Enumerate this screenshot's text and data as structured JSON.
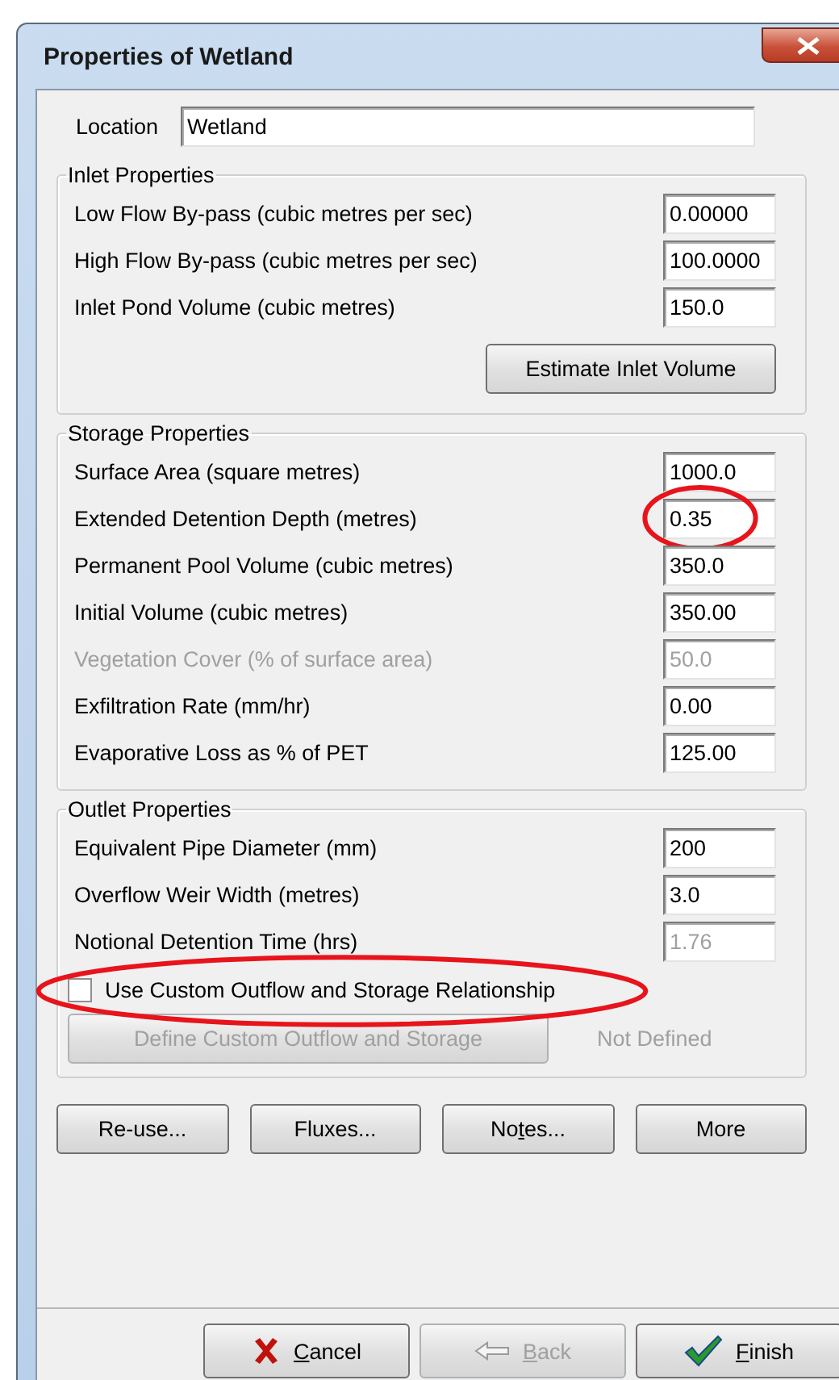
{
  "window": {
    "title": "Properties of Wetland"
  },
  "location": {
    "label": "Location",
    "value": "Wetland"
  },
  "groups": [
    {
      "title": "Inlet Properties",
      "fields": [
        {
          "label": "Low Flow By-pass (cubic metres per sec)",
          "value": "0.00000",
          "disabled": false,
          "value_disabled": false,
          "highlighted": false
        },
        {
          "label": "High Flow By-pass (cubic metres per sec)",
          "value": "100.0000",
          "disabled": false,
          "value_disabled": false,
          "highlighted": false
        },
        {
          "label": "Inlet Pond Volume (cubic metres)",
          "value": "150.0",
          "disabled": false,
          "value_disabled": false,
          "highlighted": false
        }
      ],
      "button": {
        "label": "Estimate Inlet Volume"
      }
    },
    {
      "title": "Storage Properties",
      "fields": [
        {
          "label": "Surface Area (square metres)",
          "value": "1000.0",
          "disabled": false,
          "value_disabled": false,
          "highlighted": false
        },
        {
          "label": "Extended Detention Depth (metres)",
          "value": "0.35",
          "disabled": false,
          "value_disabled": false,
          "highlighted": true
        },
        {
          "label": "Permanent Pool Volume (cubic metres)",
          "value": "350.0",
          "disabled": false,
          "value_disabled": false,
          "highlighted": false
        },
        {
          "label": "Initial Volume (cubic metres)",
          "value": "350.00",
          "disabled": false,
          "value_disabled": false,
          "highlighted": false
        },
        {
          "label": "Vegetation Cover (% of surface area)",
          "value": "50.0",
          "disabled": true,
          "value_disabled": true,
          "highlighted": false
        },
        {
          "label": "Exfiltration Rate (mm/hr)",
          "value": "0.00",
          "disabled": false,
          "value_disabled": false,
          "highlighted": false
        },
        {
          "label": "Evaporative Loss as % of PET",
          "value": "125.00",
          "disabled": false,
          "value_disabled": false,
          "highlighted": false
        }
      ]
    },
    {
      "title": "Outlet Properties",
      "fields": [
        {
          "label": "Equivalent Pipe Diameter (mm)",
          "value": "200",
          "disabled": false,
          "value_disabled": false,
          "highlighted": false
        },
        {
          "label": "Overflow Weir Width (metres)",
          "value": "3.0",
          "disabled": false,
          "value_disabled": false,
          "highlighted": false
        },
        {
          "label": "Notional Detention Time (hrs)",
          "value": "1.76",
          "disabled": false,
          "value_disabled": true,
          "highlighted": false
        }
      ],
      "custom": {
        "checkbox": {
          "label": "Use Custom Outflow and Storage Relationship",
          "checked": false,
          "highlighted": true
        },
        "define_button": {
          "label": "Define Custom Outflow and Storage",
          "disabled": true
        },
        "status": "Not Defined"
      }
    }
  ],
  "actions": [
    {
      "label": "Re-use..."
    },
    {
      "label": "Fluxes..."
    },
    {
      "before": "No",
      "key": "t",
      "after": "es..."
    },
    {
      "label": "More"
    }
  ],
  "footer": [
    {
      "kind": "cancel",
      "key": "C",
      "after": "ancel",
      "disabled": false
    },
    {
      "kind": "back",
      "key": "B",
      "after": "ack",
      "disabled": true
    },
    {
      "kind": "finish",
      "key": "F",
      "after": "inish",
      "disabled": false
    }
  ]
}
